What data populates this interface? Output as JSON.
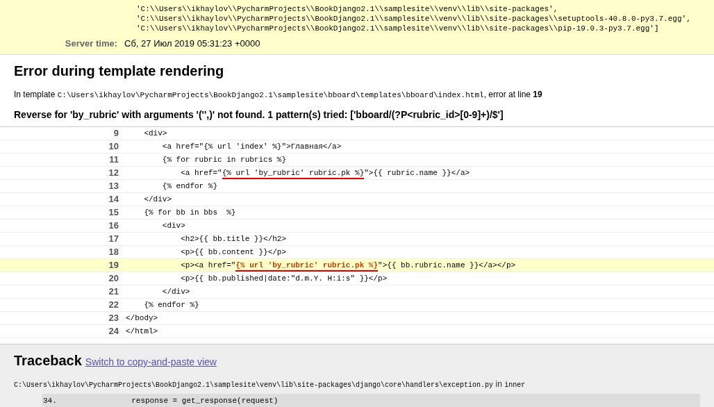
{
  "meta": {
    "path_lines": [
      "'C:\\\\Users\\\\ikhaylov\\\\PycharmProjects\\\\BookDjango2.1\\\\samplesite\\\\venv\\\\lib\\\\site-packages',",
      "'C:\\\\Users\\\\ikhaylov\\\\PycharmProjects\\\\BookDjango2.1\\\\samplesite\\\\venv\\\\lib\\\\site-packages\\\\setuptools-40.8.0-py3.7.egg',",
      "'C:\\\\Users\\\\ikhaylov\\\\PycharmProjects\\\\BookDjango2.1\\\\samplesite\\\\venv\\\\lib\\\\site-packages\\\\pip-19.0.3-py3.7.egg']"
    ],
    "server_time": {
      "label": "Server time:",
      "value": "Сб, 27 Июл 2019 05:31:23 +0000"
    }
  },
  "template_error": {
    "heading": "Error during template rendering",
    "location": {
      "prefix": "In template",
      "path": "C:\\Users\\ikhaylov\\PycharmProjects\\BookDjango2.1\\samplesite\\bboard\\templates\\bboard\\index.html",
      "middle": ", error at line",
      "line": "19"
    },
    "message": "Reverse for 'by_rubric' with arguments '('',)' not found. 1 pattern(s) tried: ['bboard/(?P<rubric_id>[0-9]+)/$']",
    "lines": [
      {
        "number": "9",
        "selected": false,
        "segments": [
          {
            "kind": "plain",
            "text": "    <div>"
          }
        ]
      },
      {
        "number": "10",
        "selected": false,
        "segments": [
          {
            "kind": "plain",
            "text": "        <a href=\"{% url 'index' %}\">Главная</a>"
          }
        ]
      },
      {
        "number": "11",
        "selected": false,
        "segments": [
          {
            "kind": "plain",
            "text": "        {% for rubric in rubrics %}"
          }
        ]
      },
      {
        "number": "12",
        "selected": false,
        "segments": [
          {
            "kind": "plain",
            "text": "            <a href=\""
          },
          {
            "kind": "underlined",
            "text": "{% url 'by_rubric' rubric.pk %}"
          },
          {
            "kind": "plain",
            "text": "\">{{ rubric.name }}</a>"
          }
        ]
      },
      {
        "number": "13",
        "selected": false,
        "segments": [
          {
            "kind": "plain",
            "text": "        {% endfor %}"
          }
        ]
      },
      {
        "number": "14",
        "selected": false,
        "segments": [
          {
            "kind": "plain",
            "text": "    </div>"
          }
        ]
      },
      {
        "number": "15",
        "selected": false,
        "segments": [
          {
            "kind": "plain",
            "text": "    {% for bb in bbs  %}"
          }
        ]
      },
      {
        "number": "16",
        "selected": false,
        "segments": [
          {
            "kind": "plain",
            "text": "        <div>"
          }
        ]
      },
      {
        "number": "17",
        "selected": false,
        "segments": [
          {
            "kind": "plain",
            "text": "            <h2>{{ bb.title }}</h2>"
          }
        ]
      },
      {
        "number": "18",
        "selected": false,
        "segments": [
          {
            "kind": "plain",
            "text": "            <p>{{ bb.content }}</p>"
          }
        ]
      },
      {
        "number": "19",
        "selected": true,
        "segments": [
          {
            "kind": "plain",
            "text": "            <p><a href=\""
          },
          {
            "kind": "error",
            "text": "{% url 'by_rubric' rubric.pk %}"
          },
          {
            "kind": "plain",
            "text": "\">{{ bb.rubric.name }}</a></p>"
          }
        ]
      },
      {
        "number": "20",
        "selected": false,
        "segments": [
          {
            "kind": "plain",
            "text": "            <p>{{ bb.published|date:\"d.m.Y. H:i:s\" }}</p>"
          }
        ]
      },
      {
        "number": "21",
        "selected": false,
        "segments": [
          {
            "kind": "plain",
            "text": "        </div>"
          }
        ]
      },
      {
        "number": "22",
        "selected": false,
        "segments": [
          {
            "kind": "plain",
            "text": "    {% endfor %}"
          }
        ]
      },
      {
        "number": "23",
        "selected": false,
        "segments": [
          {
            "kind": "plain",
            "text": "</body>"
          }
        ]
      },
      {
        "number": "24",
        "selected": false,
        "segments": [
          {
            "kind": "plain",
            "text": "</html>"
          }
        ]
      }
    ]
  },
  "traceback": {
    "heading": "Traceback",
    "switch_link": "Switch to copy-and-paste view",
    "frame": {
      "file": "C:\\Users\\ikhaylov\\PycharmProjects\\BookDjango2.1\\samplesite\\venv\\lib\\site-packages\\django\\core\\handlers\\exception.py",
      "in": "in",
      "function": "inner",
      "line": {
        "number": "34.",
        "code": "            response = get_response(request)"
      }
    }
  }
}
